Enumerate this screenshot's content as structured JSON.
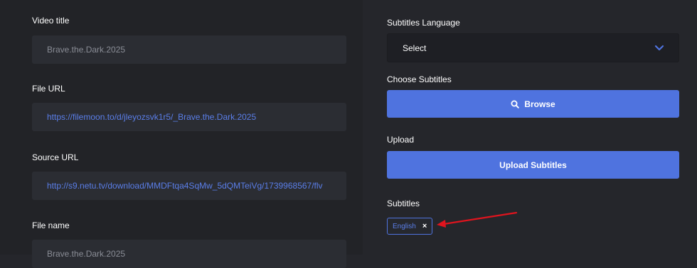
{
  "left": {
    "video_title": {
      "label": "Video title",
      "value": "Brave.the.Dark.2025"
    },
    "file_url": {
      "label": "File URL",
      "value": "https://filemoon.to/d/jleyozsvk1r5/_Brave.the.Dark.2025"
    },
    "source_url": {
      "label": "Source URL",
      "value": "http://s9.netu.tv/download/MMDFtqa4SqMw_5dQMTeiVg/1739968567/flv"
    },
    "file_name": {
      "label": "File name",
      "value": "Brave.the.Dark.2025"
    }
  },
  "right": {
    "subtitles_language": {
      "label": "Subtitles Language",
      "value": "Select",
      "icon": "chevron-down-icon"
    },
    "choose_subtitles": {
      "label": "Choose Subtitles",
      "button": "Browse",
      "icon": "search-icon"
    },
    "upload": {
      "label": "Upload",
      "button": "Upload Subtitles"
    },
    "subtitles": {
      "label": "Subtitles",
      "tags": [
        {
          "text": "English",
          "remove_glyph": "×"
        }
      ]
    }
  },
  "colors": {
    "background": "#25262b",
    "field": "#2b2d33",
    "accent": "#4f73df",
    "link": "#5a7ee8",
    "annotation_arrow": "#e0141e"
  }
}
